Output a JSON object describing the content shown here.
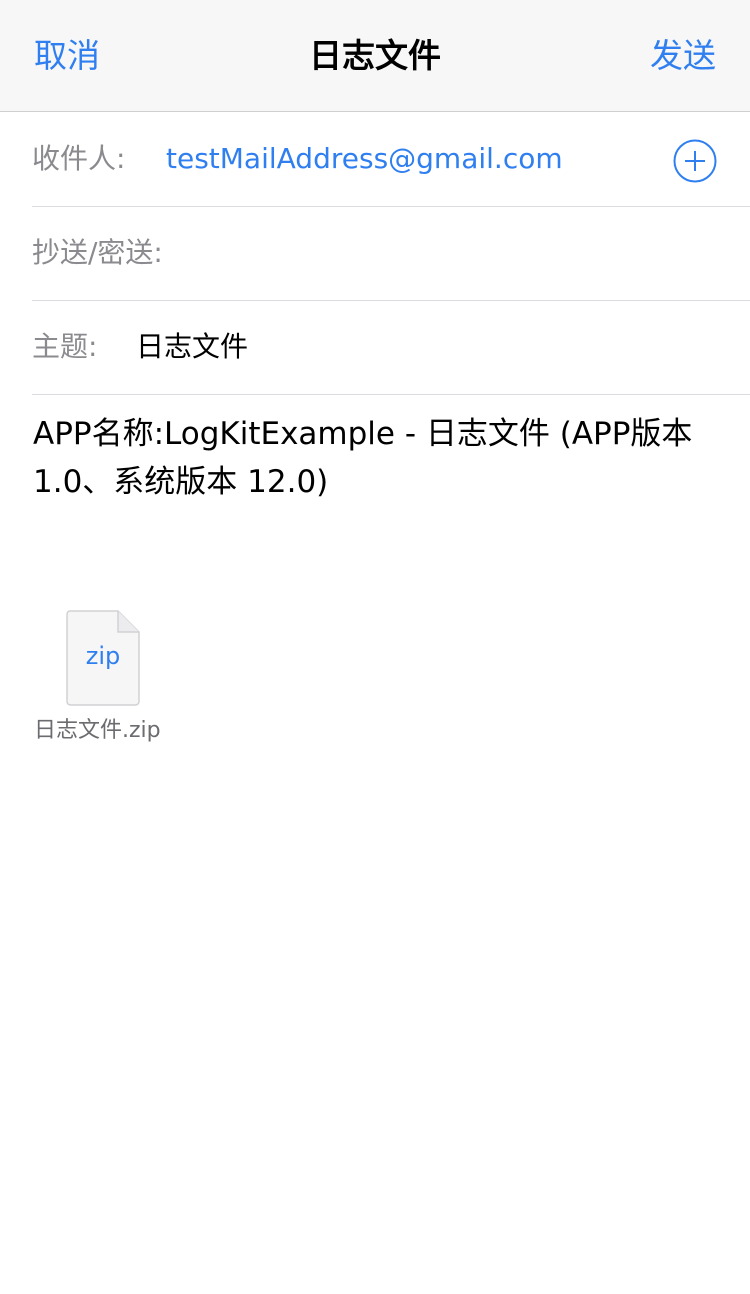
{
  "navbar": {
    "cancel_label": "取消",
    "title": "日志文件",
    "send_label": "发送"
  },
  "fields": {
    "to_label": "收件人:",
    "to_value": "testMailAddress@gmail.com",
    "cc_label": "抄送/密送:",
    "subject_label": "主题:",
    "subject_value": "日志文件"
  },
  "body": {
    "text": "APP名称:LogKitExample - 日志文件 (APP版本 1.0、系统版本 12.0)"
  },
  "attachment": {
    "extension": "zip",
    "filename": "日志文件.zip"
  },
  "colors": {
    "accent": "#2f7ff0",
    "navbar_bg": "#f7f7f7",
    "label_gray": "#8a8a8f"
  },
  "icons": {
    "add": "plus-circle-icon",
    "file": "file-icon"
  }
}
